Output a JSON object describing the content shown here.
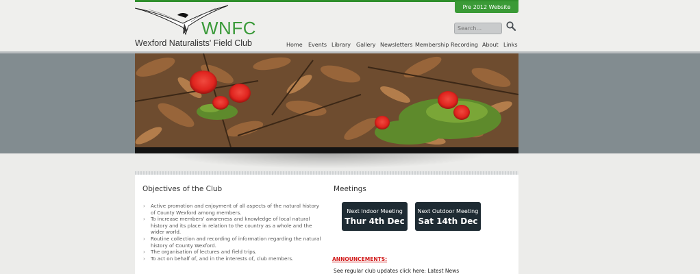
{
  "header": {
    "pre_button": "Pre 2012 Website",
    "logo_abbr": "WNFC",
    "logo_name": "Wexford Naturalists' Field Club",
    "search_placeholder": "Search..."
  },
  "nav": {
    "items": [
      "Home",
      "Events",
      "Library",
      "Gallery",
      "Newsletters",
      "Membership",
      "Recording",
      "About",
      "Links"
    ]
  },
  "objectives": {
    "heading": "Objectives of the Club",
    "items": [
      "Active promotion and enjoyment of all aspects of the natural history of County Wexford among members.",
      "To increase members' awareness and knowledge of local natural history and its place in relation to the country as a whole and the wider world.",
      "Routine collection and recording of information regarding the natural history of County Wexford.",
      "The organisation of lectures and field trips.",
      "To act on behalf of, and in the interests of, club members."
    ]
  },
  "meetings": {
    "heading": "Meetings",
    "indoor": {
      "label": "Next Indoor Meeting",
      "date": "Thur 4th Dec"
    },
    "outdoor": {
      "label": "Next Outdoor Meeting",
      "date": "Sat 14th Dec"
    },
    "announcements_label": "ANNOUNCEMENTS:",
    "regular_updates": "See regular club updates click here: Latest News"
  },
  "colors": {
    "brand_green": "#3b9a3a",
    "meeting_button": "#1e2b33",
    "announcement_red": "#d11a1a"
  }
}
